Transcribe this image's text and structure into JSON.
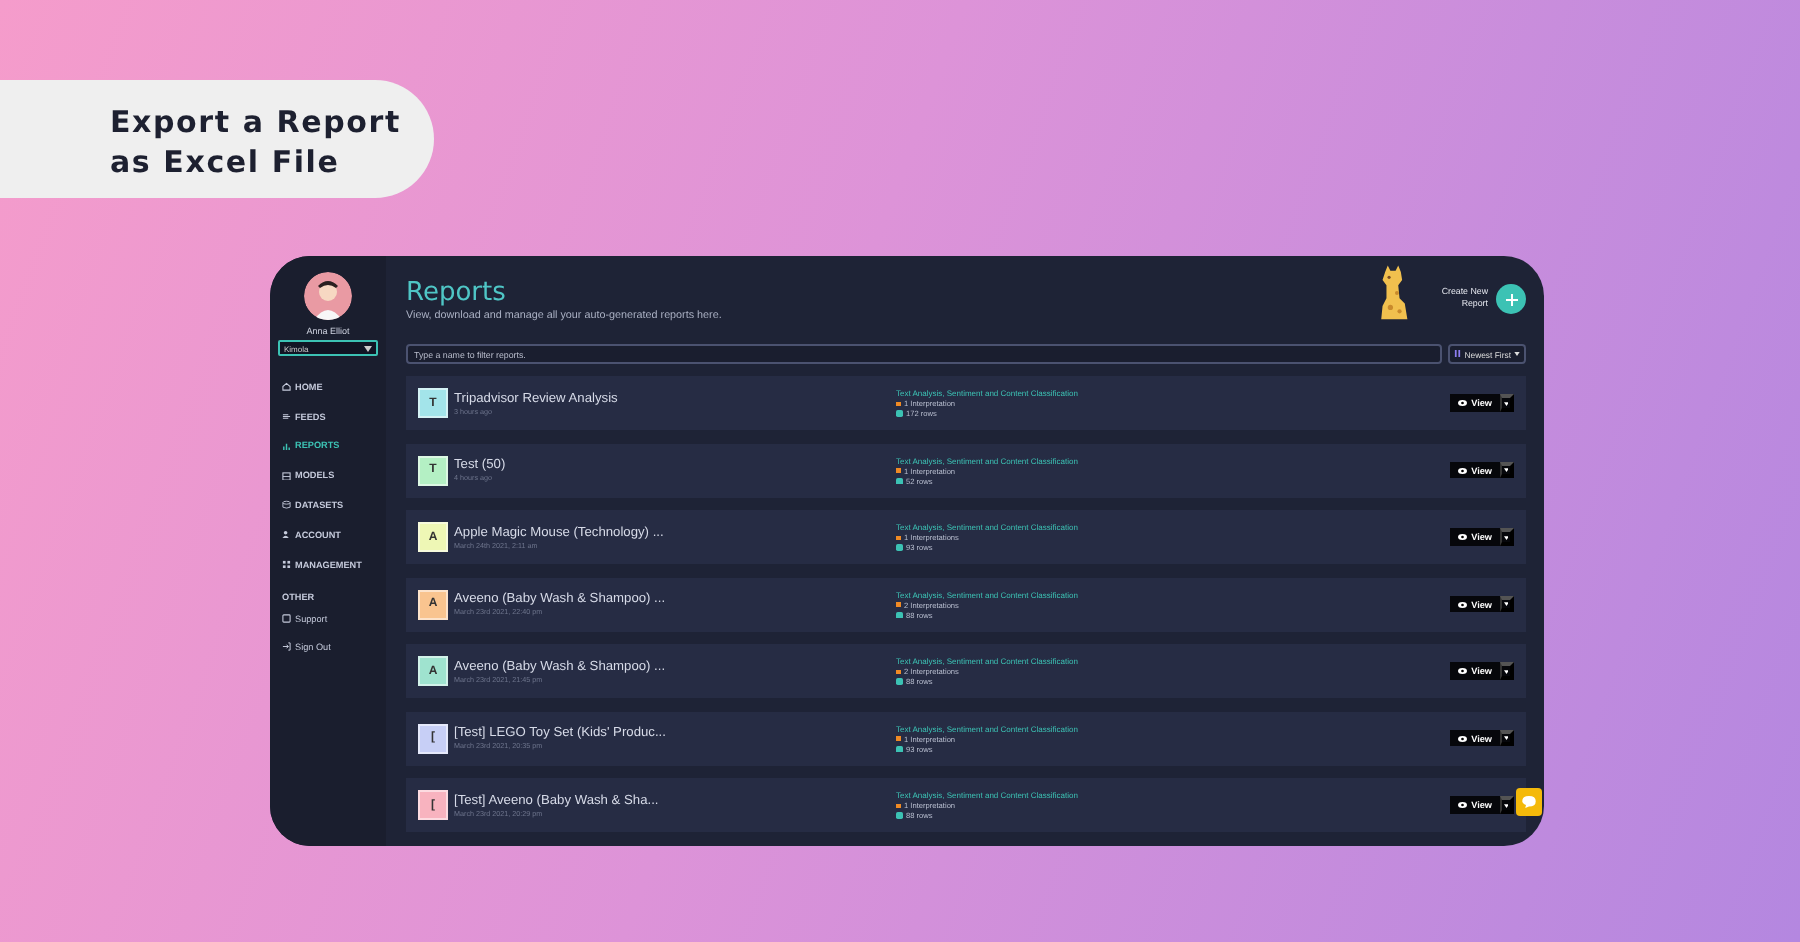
{
  "banner": {
    "text": "Export a Report as Excel File"
  },
  "sidebar": {
    "user": {
      "name": "Anna Elliot"
    },
    "workspace": {
      "value": "Kimola"
    },
    "items": [
      {
        "label": "HOME",
        "selected": false
      },
      {
        "label": "FEEDS",
        "selected": false
      },
      {
        "label": "REPORTS",
        "selected": true
      },
      {
        "label": "MODELS",
        "selected": false
      },
      {
        "label": "DATASETS",
        "selected": false
      },
      {
        "label": "ACCOUNT",
        "selected": false
      },
      {
        "label": "MANAGEMENT",
        "selected": false
      }
    ],
    "other_heading": "OTHER",
    "other_items": [
      {
        "label": "Support"
      },
      {
        "label": "Sign Out"
      }
    ]
  },
  "header": {
    "title": "Reports",
    "subtitle": "View, download and manage all your auto-generated reports here.",
    "create_label": "Create New Report"
  },
  "filter": {
    "placeholder": "Type a name to filter reports."
  },
  "sort": {
    "label": "Newest First"
  },
  "reports": [
    {
      "letter": "T",
      "color": "#a3e4ea",
      "title": "Tripadvisor Review Analysis",
      "time": "3 hours ago",
      "type": "Text Analysis, Sentiment and Content Classification",
      "interpretations": "1 Interpretation",
      "rows": "172 rows",
      "action": "View"
    },
    {
      "letter": "T",
      "color": "#b4f0c4",
      "title": "Test (50)",
      "time": "4 hours ago",
      "type": "Text Analysis, Sentiment and Content Classification",
      "interpretations": "1 Interpretation",
      "rows": "52 rows",
      "action": "View"
    },
    {
      "letter": "A",
      "color": "#eef7b5",
      "title": "Apple Magic Mouse (Technology) ...",
      "time": "March 24th 2021, 2:11 am",
      "type": "Text Analysis, Sentiment and Content Classification",
      "interpretations": "1 Interpretations",
      "rows": "93 rows",
      "action": "View"
    },
    {
      "letter": "A",
      "color": "#f9c48f",
      "title": "Aveeno (Baby Wash & Shampoo) ...",
      "time": "March 23rd 2021, 22:40 pm",
      "type": "Text Analysis, Sentiment and Content Classification",
      "interpretations": "2 Interpretations",
      "rows": "88 rows",
      "action": "View"
    },
    {
      "letter": "A",
      "color": "#9fe3cf",
      "title": "Aveeno (Baby Wash & Shampoo) ...",
      "time": "March 23rd 2021, 21:45 pm",
      "type": "Text Analysis, Sentiment and Content Classification",
      "interpretations": "2 Interpretations",
      "rows": "88 rows",
      "action": "View"
    },
    {
      "letter": "[",
      "color": "#c7cff6",
      "title": "[Test] LEGO Toy Set (Kids' Produc...",
      "time": "March 23rd 2021, 20:35 pm",
      "type": "Text Analysis, Sentiment and Content Classification",
      "interpretations": "1 Interpretation",
      "rows": "93 rows",
      "action": "View"
    },
    {
      "letter": "[",
      "color": "#f8b3bf",
      "title": "[Test] Aveeno (Baby Wash & Sha...",
      "time": "March 23rd 2021, 20:29 pm",
      "type": "Text Analysis, Sentiment and Content Classification",
      "interpretations": "1 Interpretation",
      "rows": "88 rows",
      "action": "View"
    }
  ]
}
